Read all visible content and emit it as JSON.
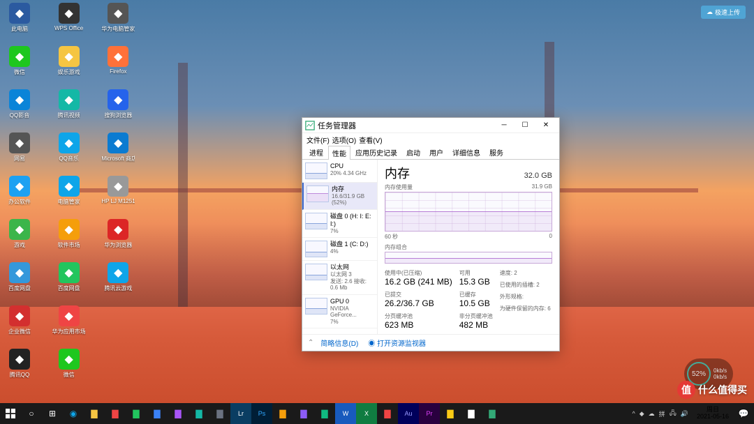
{
  "desktop": {
    "icons": [
      {
        "label": "此电脑",
        "color": "#2b5aa0"
      },
      {
        "label": "微信",
        "color": "#1ec71e"
      },
      {
        "label": "QQ影音",
        "color": "#0a84d8"
      },
      {
        "label": "网易",
        "color": "#555"
      },
      {
        "label": "办公软件",
        "color": "#1da1f2"
      },
      {
        "label": "游戏",
        "color": "#3bb54a"
      },
      {
        "label": "百度网盘",
        "color": "#3498db"
      },
      {
        "label": "企业微信",
        "color": "#d32f2f"
      },
      {
        "label": "腾讯QQ",
        "color": "#222"
      },
      {
        "label": "WPS Office",
        "color": "#333"
      },
      {
        "label": "娱乐游戏",
        "color": "#f5c542"
      },
      {
        "label": "腾讯视频",
        "color": "#14b8a6"
      },
      {
        "label": "QQ音乐",
        "color": "#0ea5e9"
      },
      {
        "label": "电脑管家",
        "color": "#0ea5e9"
      },
      {
        "label": "软件市场",
        "color": "#f59e0b"
      },
      {
        "label": "百度网盘",
        "color": "#22c55e"
      },
      {
        "label": "华为应用市场",
        "color": "#ef4444"
      },
      {
        "label": "微信",
        "color": "#1ec71e"
      },
      {
        "label": "华为电脑管家",
        "color": "#555"
      },
      {
        "label": "Firefox",
        "color": "#ff7139"
      },
      {
        "label": "搜狗浏览器",
        "color": "#2563eb"
      },
      {
        "label": "Microsoft 商店",
        "color": "#0b7bd1"
      },
      {
        "label": "HP LJ M1251...",
        "color": "#999"
      },
      {
        "label": "华为浏览器",
        "color": "#dc2626"
      },
      {
        "label": "腾讯云游戏",
        "color": "#0ea5e9"
      }
    ]
  },
  "topright": {
    "label": "极速上传"
  },
  "window": {
    "title": "任务管理器",
    "menu": [
      "文件(F)",
      "选项(O)",
      "查看(V)"
    ],
    "tabs": [
      "进程",
      "性能",
      "应用历史记录",
      "启动",
      "用户",
      "详细信息",
      "服务"
    ],
    "active_tab": 1,
    "sidebar": [
      {
        "name": "CPU",
        "sub": "20%  4.34 GHz"
      },
      {
        "name": "内存",
        "sub": "16.6/31.9 GB (52%)"
      },
      {
        "name": "磁盘 0 (H: I: E: I:)",
        "sub": "7%"
      },
      {
        "name": "磁盘 1 (C: D:)",
        "sub": "4%"
      },
      {
        "name": "以太网",
        "sub": "以太网 3",
        "sub2": "发送: 2.6  接收: 0.6 Mb"
      },
      {
        "name": "GPU 0",
        "sub": "NVIDIA GeForce...",
        "sub2": "7%"
      }
    ],
    "main": {
      "heading": "内存",
      "total": "32.0 GB",
      "chart_top_label": "内存使用量",
      "chart_top_right": "31.9 GB",
      "chart_bottom_left": "60 秒",
      "chart_bottom_right": "0",
      "comp_label": "内存组合",
      "stats": {
        "in_use_label": "使用中(已压缩)",
        "in_use": "16.2 GB (241 MB)",
        "avail_label": "可用",
        "avail": "15.3 GB",
        "committed_label": "已提交",
        "committed": "26.2/36.7 GB",
        "cached_label": "已缓存",
        "cached": "10.5 GB",
        "paged_label": "分页缓冲池",
        "paged": "623 MB",
        "nonpaged_label": "非分页缓冲池",
        "nonpaged": "482 MB"
      },
      "right_info": {
        "speed_label": "速度:",
        "slots_label": "已使用的插槽:",
        "form_label": "外形规格:",
        "reserved_label": "为硬件保留的内存:",
        "speed": "2",
        "slots": "2",
        "reserved": "6"
      }
    },
    "footer": {
      "less": "简略信息(D)",
      "monitor": "打开资源监视器"
    }
  },
  "taskbar": {
    "time": "周日",
    "date": "2021-05-16"
  },
  "widget": {
    "pct": "52%"
  },
  "watermark": {
    "text": "什么值得买",
    "char": "值"
  },
  "chart_data": {
    "type": "line",
    "title": "内存使用量",
    "ylabel": "GB",
    "ylim": [
      0,
      31.9
    ],
    "xlabel": "秒",
    "x_range": [
      60,
      0
    ],
    "series": [
      {
        "name": "内存",
        "values": [
          16.5,
          16.5,
          16.6,
          16.6,
          16.6,
          16.6,
          16.6,
          16.6,
          16.6,
          16.6
        ]
      }
    ]
  }
}
